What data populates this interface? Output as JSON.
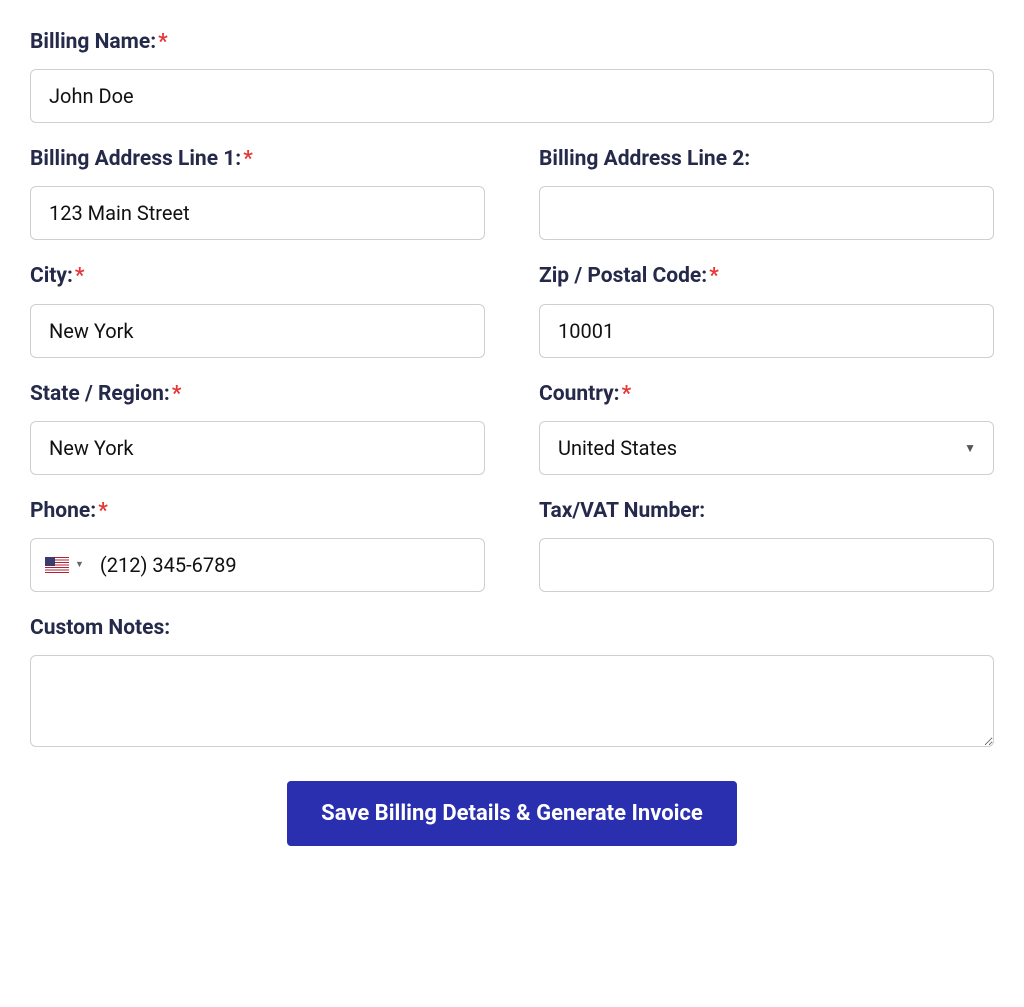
{
  "required_marker": "*",
  "fields": {
    "billing_name": {
      "label": "Billing Name:",
      "value": "John Doe",
      "required": true
    },
    "address1": {
      "label": "Billing Address Line 1:",
      "value": "123 Main Street",
      "required": true
    },
    "address2": {
      "label": "Billing Address Line 2:",
      "value": "",
      "required": false
    },
    "city": {
      "label": "City:",
      "value": "New York",
      "required": true
    },
    "zip": {
      "label": "Zip / Postal Code:",
      "value": "10001",
      "required": true
    },
    "state": {
      "label": "State / Region:",
      "value": "New York",
      "required": true
    },
    "country": {
      "label": "Country:",
      "value": "United States",
      "required": true
    },
    "phone": {
      "label": "Phone:",
      "value": "(212) 345-6789",
      "required": true,
      "flag": "us"
    },
    "tax": {
      "label": "Tax/VAT Number:",
      "value": "",
      "required": false
    },
    "notes": {
      "label": "Custom Notes:",
      "value": "",
      "required": false
    }
  },
  "submit_label": "Save Billing Details & Generate Invoice"
}
